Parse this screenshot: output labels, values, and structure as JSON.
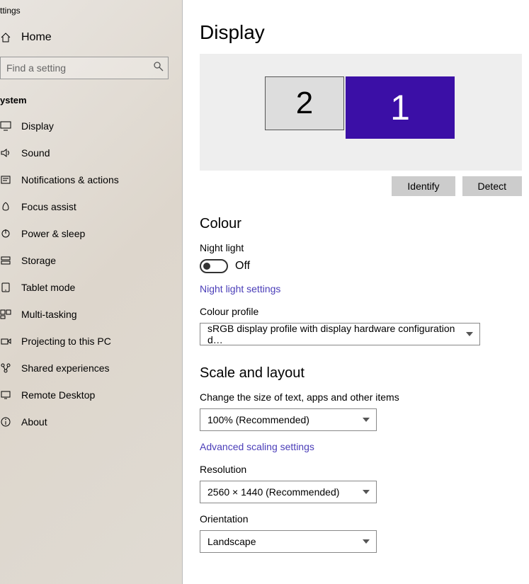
{
  "window_title": "ttings",
  "home_label": "Home",
  "search_placeholder": "Find a setting",
  "section_header": "ystem",
  "nav_items": [
    {
      "label": "Display",
      "icon": "display-icon"
    },
    {
      "label": "Sound",
      "icon": "sound-icon"
    },
    {
      "label": "Notifications & actions",
      "icon": "notifications-icon"
    },
    {
      "label": "Focus assist",
      "icon": "focus-icon"
    },
    {
      "label": "Power & sleep",
      "icon": "power-icon"
    },
    {
      "label": "Storage",
      "icon": "storage-icon"
    },
    {
      "label": "Tablet mode",
      "icon": "tablet-icon"
    },
    {
      "label": "Multi-tasking",
      "icon": "multitask-icon"
    },
    {
      "label": "Projecting to this PC",
      "icon": "project-icon"
    },
    {
      "label": "Shared experiences",
      "icon": "shared-icon"
    },
    {
      "label": "Remote Desktop",
      "icon": "remote-icon"
    },
    {
      "label": "About",
      "icon": "about-icon"
    }
  ],
  "page_title": "Display",
  "monitors": {
    "primary": "1",
    "secondary": "2"
  },
  "identify_btn": "Identify",
  "detect_btn": "Detect",
  "colour": {
    "heading": "Colour",
    "night_light_label": "Night light",
    "night_light_state": "Off",
    "night_light_link": "Night light settings",
    "profile_label": "Colour profile",
    "profile_value": "sRGB display profile with display hardware configuration d…"
  },
  "scale": {
    "heading": "Scale and layout",
    "size_label": "Change the size of text, apps and other items",
    "size_value": "100% (Recommended)",
    "advanced_link": "Advanced scaling settings",
    "resolution_label": "Resolution",
    "resolution_value": "2560 × 1440 (Recommended)",
    "orientation_label": "Orientation",
    "orientation_value": "Landscape"
  }
}
